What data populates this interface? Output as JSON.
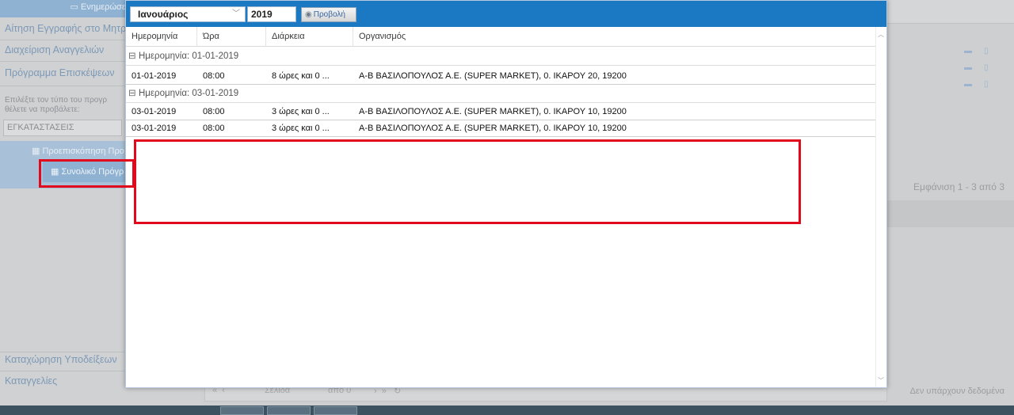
{
  "sidebar": {
    "info_label": "Ενημερώσεις",
    "link_registration": "Αίτηση Εγγραφής στο Μητρ",
    "link_announcements": "Διαχείριση Αναγγελιών",
    "link_schedule": "Πρόγραμμα Επισκέψεων",
    "hint_line1": "Επιλέξτε τον τύπο του προγρ",
    "hint_line2": "θέλετε να προβάλετε:",
    "select_value": "ΕΓΚΑΤΑΣΤΑΣΕΙΣ",
    "preview_button": "Προεπισκόπηση Προ",
    "summary_button": "Συνολικό Πρόγρ",
    "link_indications": "Καταχώρηση Υποδείξεων",
    "link_complaints": "Καταγγελίες"
  },
  "background": {
    "showing_text": "Εμφάνιση 1 - 3 από 3",
    "pager_page_label": "Σελίδα",
    "pager_of_label": "από 0",
    "no_data_text": "Δεν υπάρχουν δεδομένα"
  },
  "modal": {
    "month_value": "Ιανουάριος",
    "year_value": "2019",
    "view_button": "Προβολή",
    "columns": [
      "Ημερομηνία",
      "Ώρα",
      "Διάρκεια",
      "Οργανισμός"
    ],
    "groups": [
      {
        "label": "Ημερομηνία: 01-01-2019",
        "rows": [
          [
            "01-01-2019",
            "08:00",
            "8 ώρες και 0 ...",
            "Α-Β ΒΑΣΙΛΟΠΟΥΛΟΣ Α.Ε. (SUPER MARKET), 0. ΙΚΑΡΟΥ 20, 19200"
          ]
        ]
      },
      {
        "label": "Ημερομηνία: 03-01-2019",
        "rows": [
          [
            "03-01-2019",
            "08:00",
            "3 ώρες και 0 ...",
            "Α-Β ΒΑΣΙΛΟΠΟΥΛΟΣ Α.Ε. (SUPER MARKET), 0. ΙΚΑΡΟΥ 10, 19200"
          ],
          [
            "03-01-2019",
            "08:00",
            "3 ώρες και 0 ...",
            "Α-Β ΒΑΣΙΛΟΠΟΥΛΟΣ Α.Ε. (SUPER MARKET), 0. ΙΚΑΡΟΥ 10, 19200"
          ]
        ]
      }
    ]
  },
  "colors": {
    "toolbar": "#1b79c3",
    "highlight": "#e00a1c"
  }
}
